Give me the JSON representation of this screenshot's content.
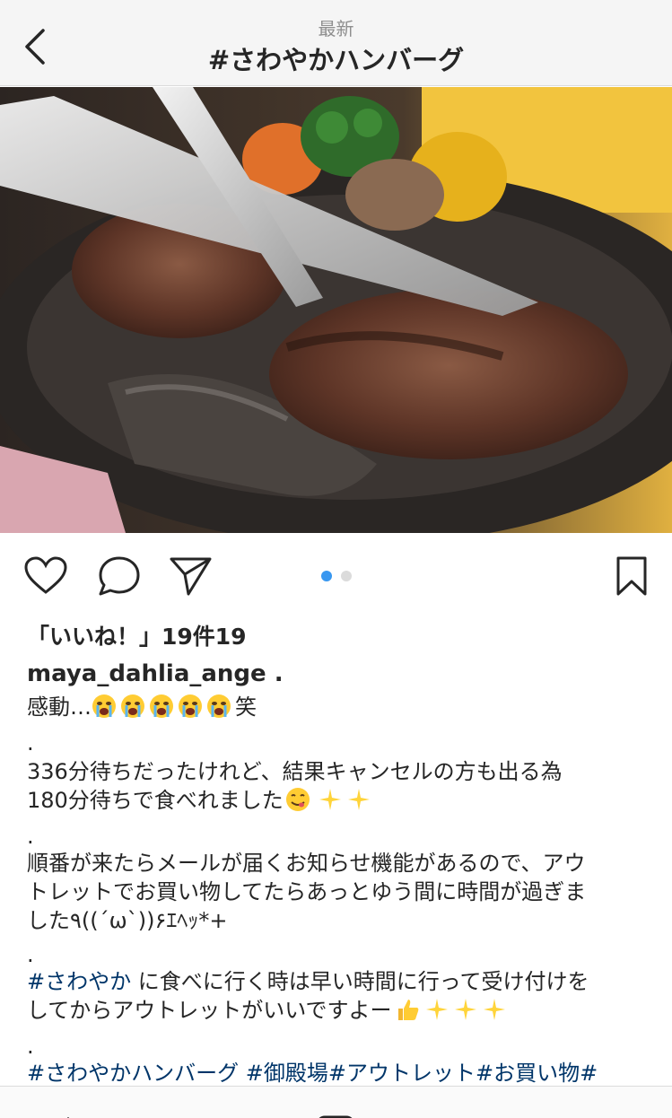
{
  "header": {
    "subtitle": "最新",
    "title": "#さわやかハンバーグ"
  },
  "photo": {
    "subject": "hamburg steak on cast-iron sizzling plate"
  },
  "carousel": {
    "count": 2,
    "active_index": 0,
    "active_color": "#3897f0",
    "inactive_color": "#dbdbdb"
  },
  "post": {
    "likes_text": "「いいね！」19件19",
    "username": "maya_dahlia_ange .",
    "line1_prefix": "感動…",
    "line1_suffix": "笑",
    "dot1": ".",
    "line2": "336分待ちだったけれど、結果キャンセルの方も出る為",
    "line3": "180分待ちで食べれました",
    "dot2": ".",
    "line4": "順番が来たらメールが届くお知らせ機能があるので、アウ",
    "line5": "トレットでお買い物してたらあっとゆう間に時間が過ぎま",
    "line6": "した٩((´ω`))۶ｴﾍｯ*+",
    "dot3": ".",
    "line7_tag": "#さわやか",
    "line7_text": " に食べに行く時は早い時間に行って受け付けを",
    "line8": "してからアウトレットがいいですよー",
    "dot4": ".",
    "line9_tags": "#さわやかハンバーグ #御殿場#アウトレット#お買い物#"
  },
  "icons": {
    "back": "chevron-left-icon",
    "like": "heart-icon",
    "comment": "comment-icon",
    "share": "paper-plane-icon",
    "save": "bookmark-icon",
    "crying": "loudly-crying-face-emoji",
    "yum": "face-savoring-food-emoji",
    "sparkles": "sparkles-emoji",
    "thumbs": "thumbs-up-emoji"
  },
  "colors": {
    "hashtag": "#003569",
    "text": "#262626",
    "muted": "#8e8e8e"
  }
}
